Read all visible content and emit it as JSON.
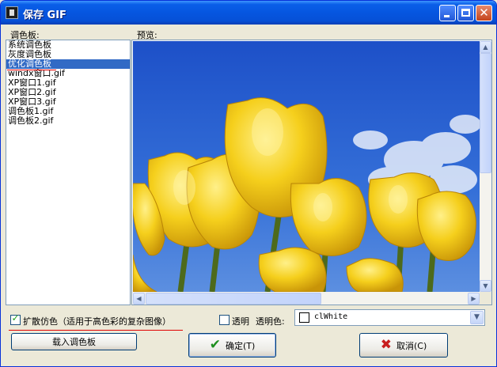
{
  "window": {
    "title": "保存 GIF"
  },
  "labels": {
    "palette": "调色板:",
    "preview": "预览:"
  },
  "palette_list": {
    "items": [
      "系统调色板",
      "灰度调色板",
      "优化调色板",
      "windx窗口.gif",
      "XP窗口1.gif",
      "XP窗口2.gif",
      "XP窗口3.gif",
      "调色板1.gif",
      "调色板2.gif"
    ],
    "selected_index": 2
  },
  "options": {
    "dither_label": "扩散仿色（适用于高色彩的复杂图像）",
    "dither_checked": true,
    "transparent_label": "透明",
    "transparent_checked": false,
    "transparent_color_label": "透明色:",
    "transparent_color_value": "clWhite"
  },
  "buttons": {
    "load_palette": "载入调色板",
    "ok": "确定(T)",
    "cancel": "取消(C)"
  },
  "colors": {
    "selection": "#316ac5",
    "annotation_red": "#e00000",
    "sky": "#2a5ed0",
    "tulip": "#f5cf1c"
  }
}
